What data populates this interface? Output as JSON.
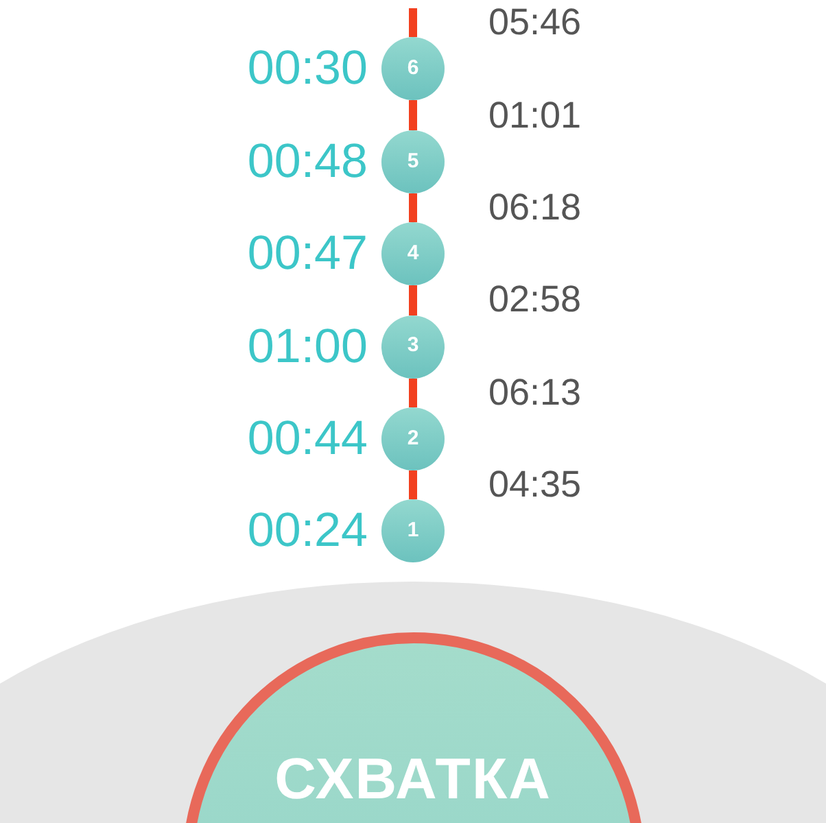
{
  "contractions": [
    {
      "number": "6",
      "duration": "00:30",
      "interval": "05:46"
    },
    {
      "number": "5",
      "duration": "00:48",
      "interval": "01:01"
    },
    {
      "number": "4",
      "duration": "00:47",
      "interval": "06:18"
    },
    {
      "number": "3",
      "duration": "01:00",
      "interval": "02:58"
    },
    {
      "number": "2",
      "duration": "00:44",
      "interval": "06:13"
    },
    {
      "number": "1",
      "duration": "00:24",
      "interval": "04:35"
    }
  ],
  "main_button": {
    "label": "СХВАТКА"
  }
}
